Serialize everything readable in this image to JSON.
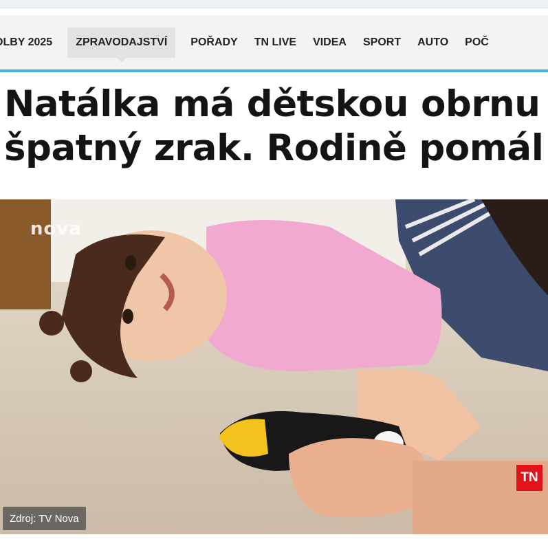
{
  "nav": {
    "items": [
      {
        "label": "OLBY 2025",
        "active": false
      },
      {
        "label": "ZPRAVODAJSTVÍ",
        "active": true
      },
      {
        "label": "POŘADY",
        "active": false
      },
      {
        "label": "TN LIVE",
        "active": false
      },
      {
        "label": "VIDEA",
        "active": false
      },
      {
        "label": "SPORT",
        "active": false
      },
      {
        "label": "AUTO",
        "active": false
      },
      {
        "label": "POČ",
        "active": false
      }
    ],
    "accent_color": "#45b3dd"
  },
  "article": {
    "headline_lines": [
      "Natálka má dětskou obrnu",
      "špatný zrak. Rodině pomál"
    ]
  },
  "media": {
    "watermark": "nova",
    "badge": "TN",
    "badge_color": "#e2141b",
    "caption": "Zdroj: TV Nova"
  }
}
